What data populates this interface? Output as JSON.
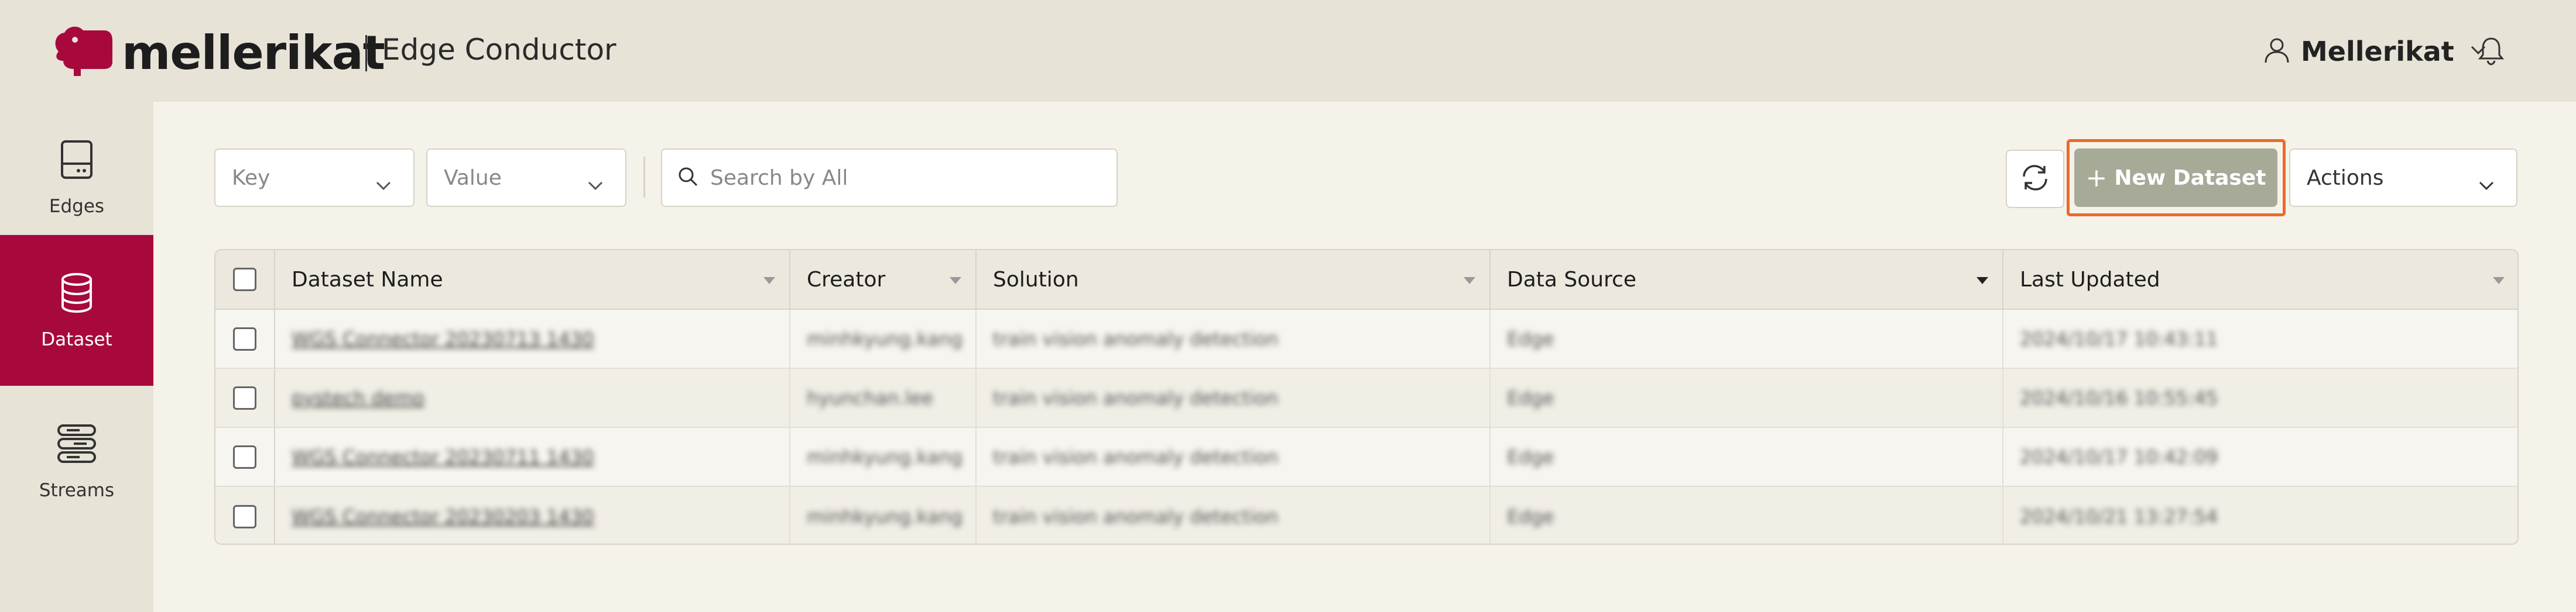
{
  "header": {
    "brand": "mellerikat",
    "app_name": "Edge Conductor",
    "user_name": "Mellerikat"
  },
  "sidebar": {
    "items": [
      {
        "label": "Edges",
        "icon": "hard-drive-icon",
        "active": false
      },
      {
        "label": "Dataset",
        "icon": "database-icon",
        "active": true
      },
      {
        "label": "Streams",
        "icon": "streams-icon",
        "active": false
      }
    ]
  },
  "toolbar": {
    "key_placeholder": "Key",
    "value_placeholder": "Value",
    "search_placeholder": "Search by All",
    "new_dataset_label": "New Dataset",
    "actions_label": "Actions"
  },
  "table": {
    "columns": [
      "Dataset Name",
      "Creator",
      "Solution",
      "Data Source",
      "Last Updated"
    ],
    "rows": [
      {
        "name": "WGS Connector 20230713 1430",
        "creator": "minhkyung.kang",
        "solution": "train vision anomaly detection",
        "source": "Edge",
        "updated": "2024/10/17 10:43:11"
      },
      {
        "name": "pystech demo",
        "creator": "hyunchan.lee",
        "solution": "train vision anomaly detection",
        "source": "Edge",
        "updated": "2024/10/16 10:55:45"
      },
      {
        "name": "WGS Connector 20230711 1430",
        "creator": "minhkyung.kang",
        "solution": "train vision anomaly detection",
        "source": "Edge",
        "updated": "2024/10/17 10:42:09"
      },
      {
        "name": "WGS Connector 20230203 1430",
        "creator": "minhkyung.kang",
        "solution": "train vision anomaly detection",
        "source": "Edge",
        "updated": "2024/10/21 13:27:54"
      }
    ]
  },
  "colors": {
    "accent": "#a8093d",
    "highlight": "#ea6a2a",
    "button_disabled": "#a8aa98"
  }
}
